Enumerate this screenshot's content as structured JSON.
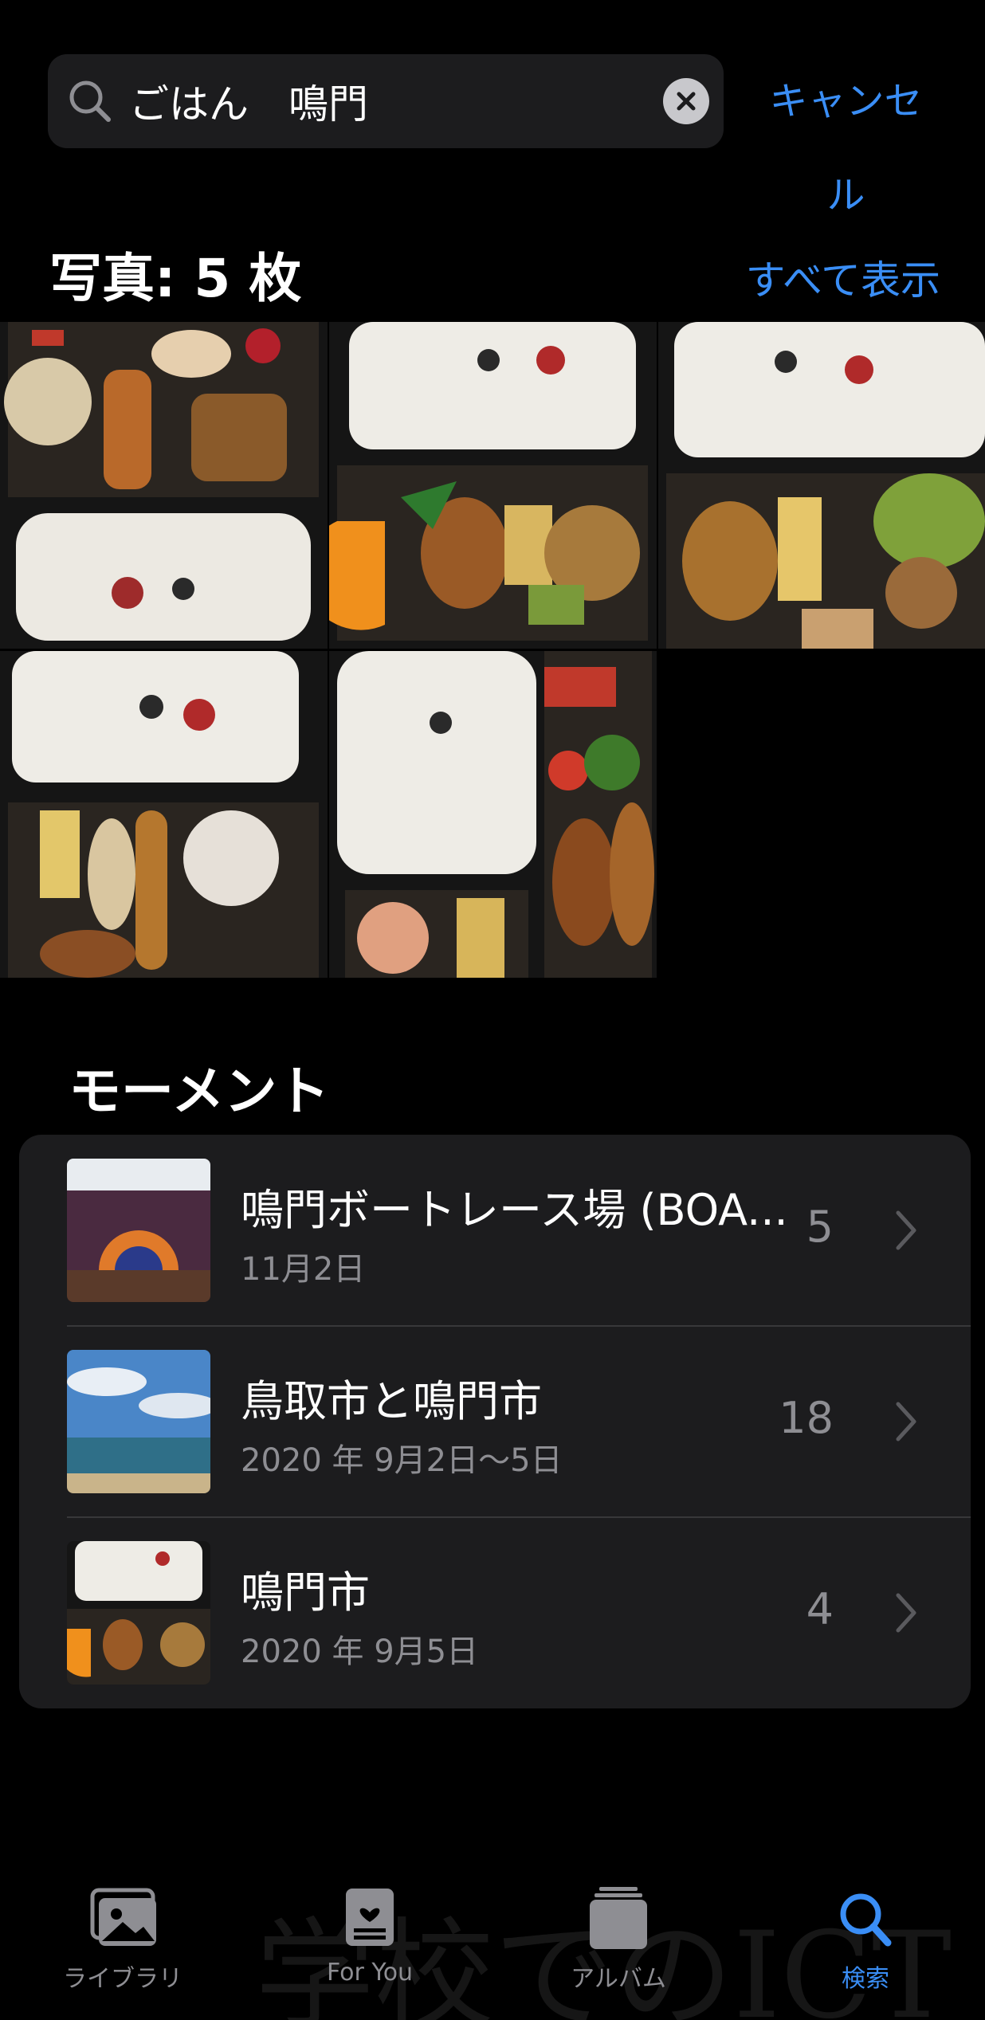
{
  "search": {
    "query": "ごはん　鳴門",
    "cancel_label": "キャンセル"
  },
  "photos": {
    "title": "写真: 5 枚",
    "show_all_label": "すべて表示",
    "count": 5
  },
  "moments": {
    "title": "モーメント",
    "items": [
      {
        "title": "鳴門ボートレース場 (BOA...",
        "date": "11月2日",
        "count": "5"
      },
      {
        "title": "鳥取市と鳴門市",
        "date": "2020 年 9月2日〜5日",
        "count": "18"
      },
      {
        "title": "鳴門市",
        "date": "2020 年 9月5日",
        "count": "4"
      }
    ]
  },
  "tabbar": {
    "items": [
      {
        "label": "ライブラリ",
        "icon": "photo-library-icon"
      },
      {
        "label": "For You",
        "icon": "for-you-icon"
      },
      {
        "label": "アルバム",
        "icon": "albums-icon"
      },
      {
        "label": "検索",
        "icon": "search-icon",
        "active": true
      }
    ]
  },
  "watermark": "学校でのICT",
  "colors": {
    "accent": "#3a8ef6",
    "background": "#000000",
    "card": "#1c1c1e",
    "secondary_text": "#8e8e93"
  }
}
